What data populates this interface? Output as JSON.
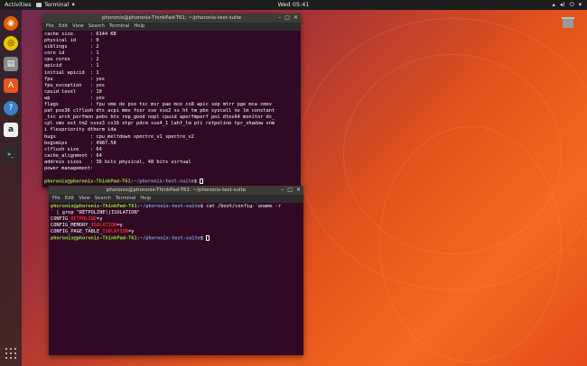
{
  "topbar": {
    "activities": "Activities",
    "app_name": "Terminal",
    "app_arrow": "▾",
    "clock": "Wed 05:41",
    "sys_icons": [
      "network-icon",
      "volume-icon",
      "power-icon"
    ],
    "sys_arrow": "▾"
  },
  "dock": {
    "items": [
      {
        "name": "firefox-icon",
        "color": "#e66000",
        "glyph": "◉"
      },
      {
        "name": "rhythmbox-icon",
        "color": "#f0c400",
        "glyph": "◎"
      },
      {
        "name": "files-icon",
        "color": "#8a8a8a",
        "glyph": "▤"
      },
      {
        "name": "software-icon",
        "color": "#e95420",
        "glyph": "A"
      },
      {
        "name": "help-icon",
        "color": "#3b82c4",
        "glyph": "?"
      },
      {
        "name": "amazon-icon",
        "color": "#f0f0f0",
        "glyph": "a"
      },
      {
        "name": "terminal-icon",
        "color": "#2b2b2b",
        "glyph": ">_"
      }
    ]
  },
  "terminal1": {
    "title": "phoronix@phoronix-ThinkPad-T61: ~/phoronix-test-suite",
    "menu": [
      "File",
      "Edit",
      "View",
      "Search",
      "Terminal",
      "Help"
    ],
    "lines": [
      "cache size      : 6144 KB",
      "physical id     : 0",
      "siblings        : 2",
      "core id         : 1",
      "cpu cores       : 2",
      "apicid          : 1",
      "initial apicid  : 1",
      "fpu             : yes",
      "fpu_exception   : yes",
      "cpuid level     : 10",
      "wp              : yes",
      "flags           : fpu vme de pse tsc msr pae mce cx8 apic sep mtrr pge mca cmov",
      "pat pse36 clflush dts acpi mmx fxsr sse sse2 ss ht tm pbe syscall nx lm constant",
      "_tsc arch_perfmon pebs bts rep_good nopl cpuid aperfmperf pni dtes64 monitor ds_",
      "cpl vmx est tm2 ssse3 cx16 xtpr pdcm sse4_1 lahf_lm pti retpoline tpr_shadow vnm",
      "i flexpriority dtherm ida",
      "bugs            : cpu_meltdown spectre_v1 spectre_v2",
      "bogomips        : 4987.58",
      "clflush size    : 64",
      "cache_alignment : 64",
      "address sizes   : 36 bits physical, 48 bits virtual",
      "power management:",
      ""
    ],
    "prompt_user": "phoronix@phoronix-ThinkPad-T61",
    "prompt_sep": ":",
    "prompt_path": "~/phoronix-test-suite",
    "prompt_end": "$ "
  },
  "terminal2": {
    "title": "phoronix@phoronix-ThinkPad-T61: ~/phoronix-test-suite",
    "menu": [
      "File",
      "Edit",
      "View",
      "Search",
      "Terminal",
      "Help"
    ],
    "prompt_user": "phoronix@phoronix-ThinkPad-T61",
    "prompt_sep": ":",
    "prompt_path": "~/phoronix-test-suite",
    "prompt_end": "$ ",
    "command": "cat /boot/config-`uname -r",
    "command_cont": "` | grep \"RETPOLINE\\|ISOLATION\"",
    "out1_pre": "CONFIG_",
    "out1_match": "RETPOLINE",
    "out1_post": "=y",
    "out2_pre": "CONFIG_MEMORY_",
    "out2_match": "ISOLATION",
    "out2_post": "=y",
    "out3_pre": "CONFIG_PAGE_TABLE_",
    "out3_match": "ISOLATION",
    "out3_post": "=y"
  }
}
